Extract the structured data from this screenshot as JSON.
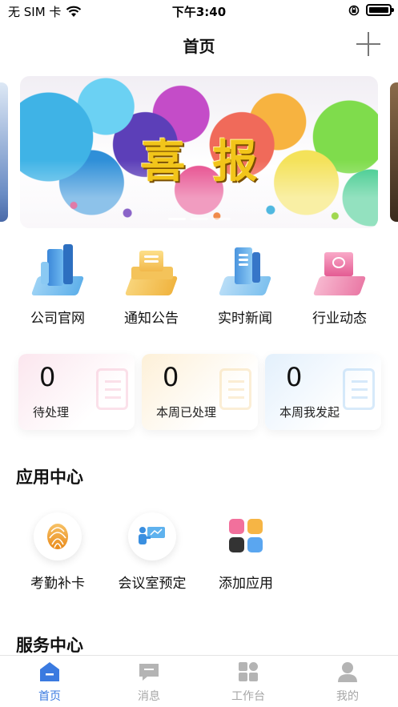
{
  "status_bar": {
    "carrier": "无 SIM 卡",
    "time": "下午3:40"
  },
  "nav": {
    "title": "首页"
  },
  "banner": {
    "text": "喜报"
  },
  "quick_links": [
    {
      "label": "公司官网",
      "icon": "building-icon"
    },
    {
      "label": "通知公告",
      "icon": "notice-icon"
    },
    {
      "label": "实时新闻",
      "icon": "news-icon"
    },
    {
      "label": "行业动态",
      "icon": "industry-icon"
    }
  ],
  "stats": [
    {
      "value": "0",
      "label": "待处理",
      "color": "#f3a9c2"
    },
    {
      "value": "0",
      "label": "本周已处理",
      "color": "#f4cf8a"
    },
    {
      "value": "0",
      "label": "本周我发起",
      "color": "#8ec2f0"
    }
  ],
  "app_center": {
    "title": "应用中心",
    "apps": [
      {
        "label": "考勤补卡",
        "icon": "fingerprint-icon"
      },
      {
        "label": "会议室预定",
        "icon": "meeting-icon"
      },
      {
        "label": "添加应用",
        "icon": "add-app-icon"
      }
    ]
  },
  "service_center": {
    "title": "服务中心"
  },
  "tab_bar": [
    {
      "label": "首页",
      "icon": "home-icon",
      "active": true
    },
    {
      "label": "消息",
      "icon": "message-icon",
      "active": false
    },
    {
      "label": "工作台",
      "icon": "workbench-icon",
      "active": false
    },
    {
      "label": "我的",
      "icon": "profile-icon",
      "active": false
    }
  ],
  "colors": {
    "accent": "#3a7ae0",
    "inactive": "#a6a6a6"
  }
}
